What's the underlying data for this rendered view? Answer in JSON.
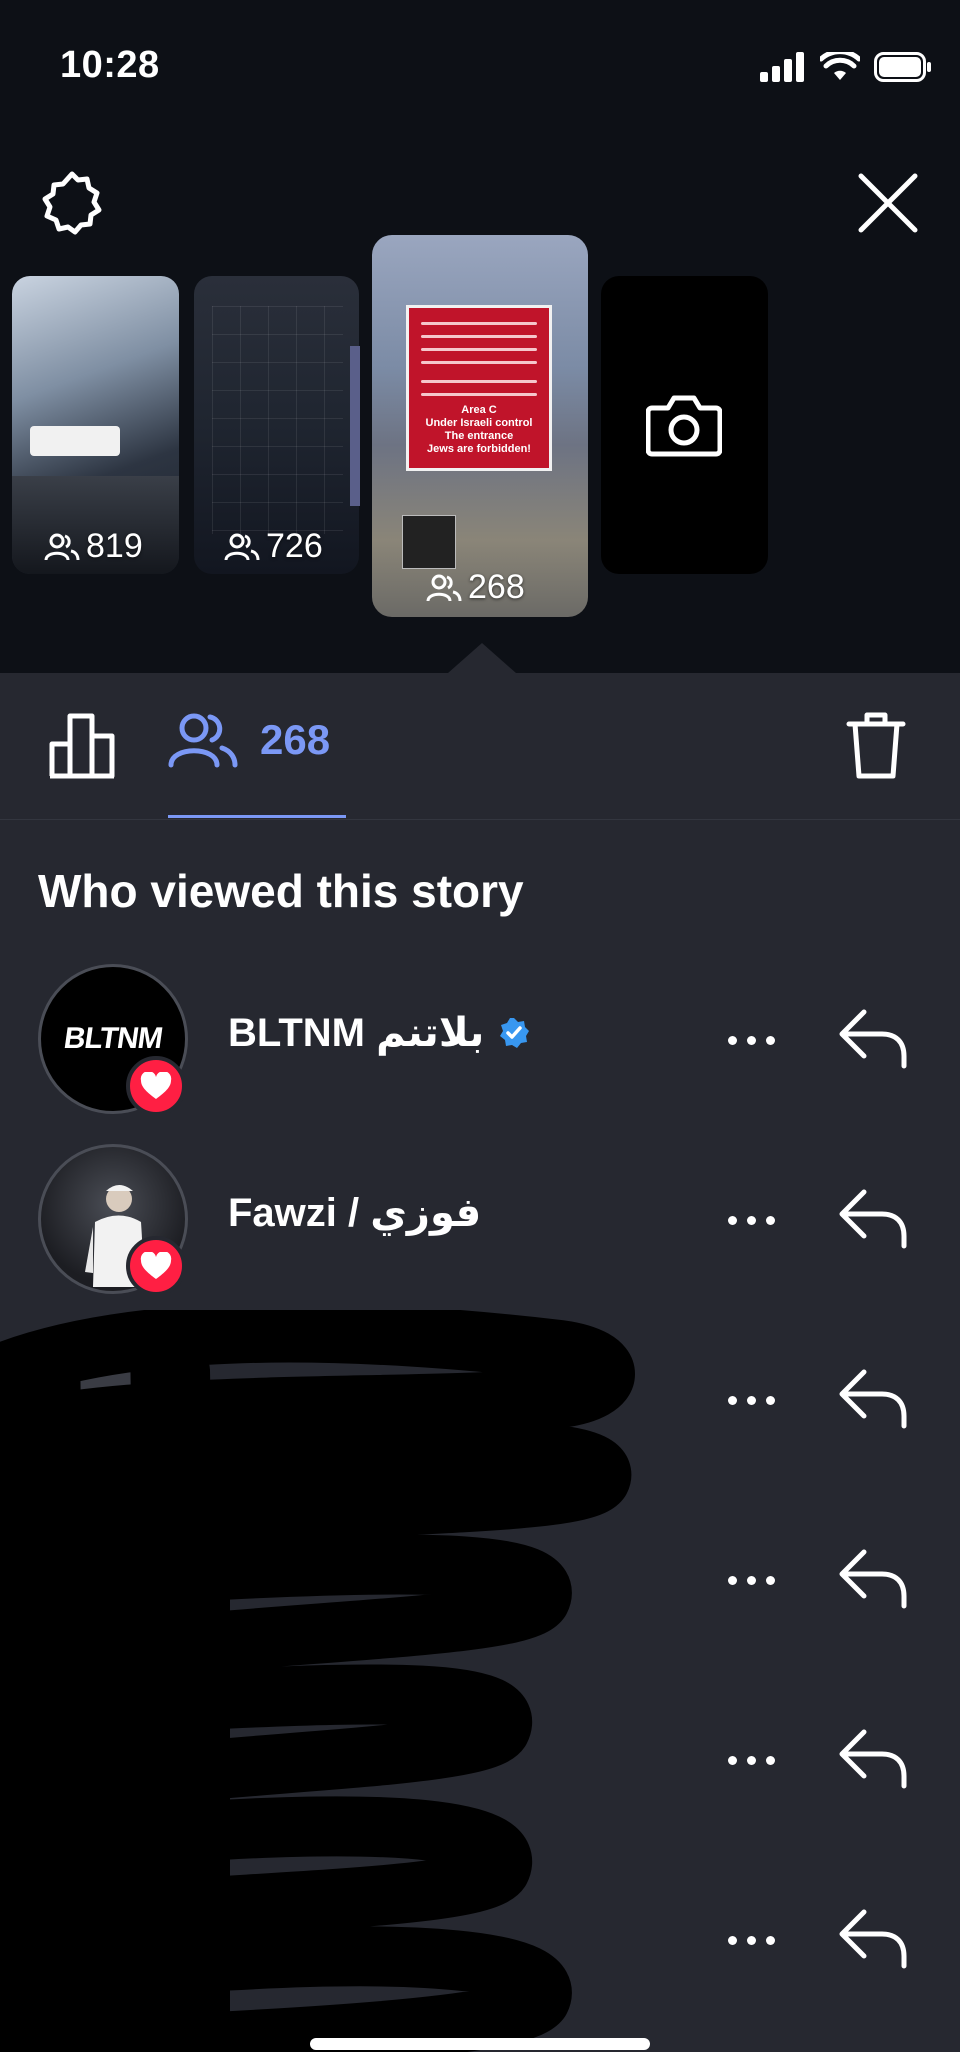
{
  "status_bar": {
    "time": "10:28"
  },
  "stories": [
    {
      "viewers": "819"
    },
    {
      "viewers": "726"
    },
    {
      "viewers": "268",
      "sign_text": [
        "Area C",
        "Under Israeli control",
        "The entrance",
        "Jews are forbidden!"
      ]
    }
  ],
  "tabs": {
    "viewers_count": "268"
  },
  "section_title": "Who viewed this story",
  "viewers": [
    {
      "name": "BLTNM بلاتنم",
      "verified": true,
      "liked": true,
      "avatar_text": "BLTNM"
    },
    {
      "name": "Fawzi / فوزي",
      "verified": false,
      "liked": true
    },
    {
      "name": "",
      "liked": true
    },
    {
      "name": "",
      "liked": false
    },
    {
      "name": "",
      "liked": false
    },
    {
      "name": "",
      "liked": true
    }
  ],
  "colors": {
    "accent": "#7b98f5",
    "heart": "#ff1f43",
    "verified": "#3897f0",
    "background": "#262830",
    "top_background": "#0d1016"
  }
}
